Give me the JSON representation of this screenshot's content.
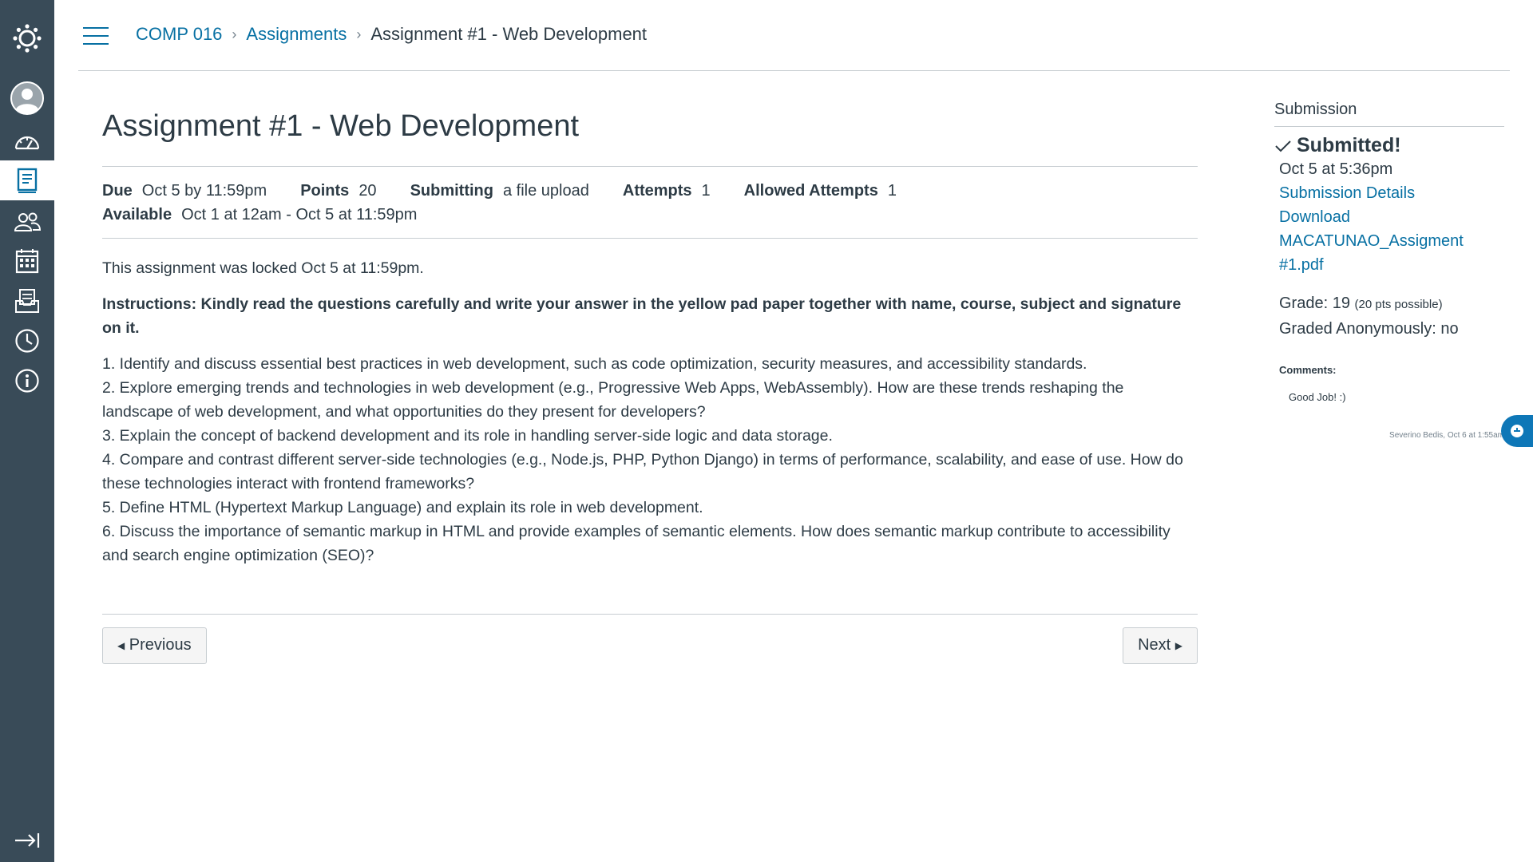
{
  "nav": {
    "items": [
      {
        "key": "logo",
        "icon": "canvas-logo-icon"
      },
      {
        "key": "account",
        "icon": "account-avatar-icon"
      },
      {
        "key": "dashboard",
        "icon": "dashboard-icon"
      },
      {
        "key": "courses",
        "icon": "courses-icon",
        "active": true
      },
      {
        "key": "groups",
        "icon": "groups-icon"
      },
      {
        "key": "calendar",
        "icon": "calendar-icon"
      },
      {
        "key": "inbox",
        "icon": "inbox-icon"
      },
      {
        "key": "history",
        "icon": "history-icon"
      },
      {
        "key": "help",
        "icon": "help-icon"
      },
      {
        "key": "collapse",
        "icon": "collapse-nav-icon"
      }
    ]
  },
  "breadcrumb": {
    "course": "COMP 016",
    "section": "Assignments",
    "current": "Assignment #1 - Web Development"
  },
  "assignment": {
    "title": "Assignment #1 - Web Development",
    "due_label": "Due",
    "due_value": "Oct 5 by 11:59pm",
    "points_label": "Points",
    "points_value": "20",
    "submitting_label": "Submitting",
    "submitting_value": "a file upload",
    "attempts_label": "Attempts",
    "attempts_value": "1",
    "allowed_attempts_label": "Allowed Attempts",
    "allowed_attempts_value": "1",
    "available_label": "Available",
    "available_value": "Oct 1 at 12am - Oct 5 at 11:59pm",
    "locked_notice": "This assignment was locked Oct 5 at 11:59pm.",
    "instructions": "Instructions: Kindly read the questions carefully and write your answer in the yellow pad paper together with name, course, subject and signature on it.",
    "questions": [
      "1. Identify and discuss essential best practices in web development, such as code optimization, security measures, and accessibility standards.",
      "2. Explore emerging trends and technologies in web development (e.g., Progressive Web Apps, WebAssembly). How are these trends reshaping the landscape of web development, and what opportunities do they present for developers?",
      "3. Explain the concept of backend development and its role in handling server-side logic and data storage.",
      "4. Compare and contrast different server-side technologies (e.g., Node.js, PHP, Python Django) in terms of performance, scalability, and ease of use. How do these technologies interact with frontend frameworks?",
      "5. Define HTML (Hypertext Markup Language) and explain its role in web development.",
      "6. Discuss the importance of semantic markup in HTML and provide examples of semantic elements. How does semantic markup contribute to accessibility and search engine optimization (SEO)?"
    ]
  },
  "pager": {
    "previous_label": "Previous",
    "next_label": "Next"
  },
  "submission": {
    "heading": "Submission",
    "status": "Submitted!",
    "date": "Oct 5 at 5:36pm",
    "details_link": "Submission Details",
    "download_label": "Download",
    "file_name": "MACATUNAO_Assigment #1.pdf",
    "grade_label": "Grade: 19",
    "grade_possible": "(20 pts possible)",
    "graded_anonymously": "Graded Anonymously: no",
    "comments_label": "Comments:",
    "comment_text": "Good Job! :)",
    "comment_author": "Severino Bedis, Oct 6 at 1:55am"
  },
  "colors": {
    "nav_bg": "#394b58",
    "link": "#0770a3",
    "text": "#2d3b45",
    "rule": "#c7cdd1",
    "help_tab": "#0e77b7"
  }
}
